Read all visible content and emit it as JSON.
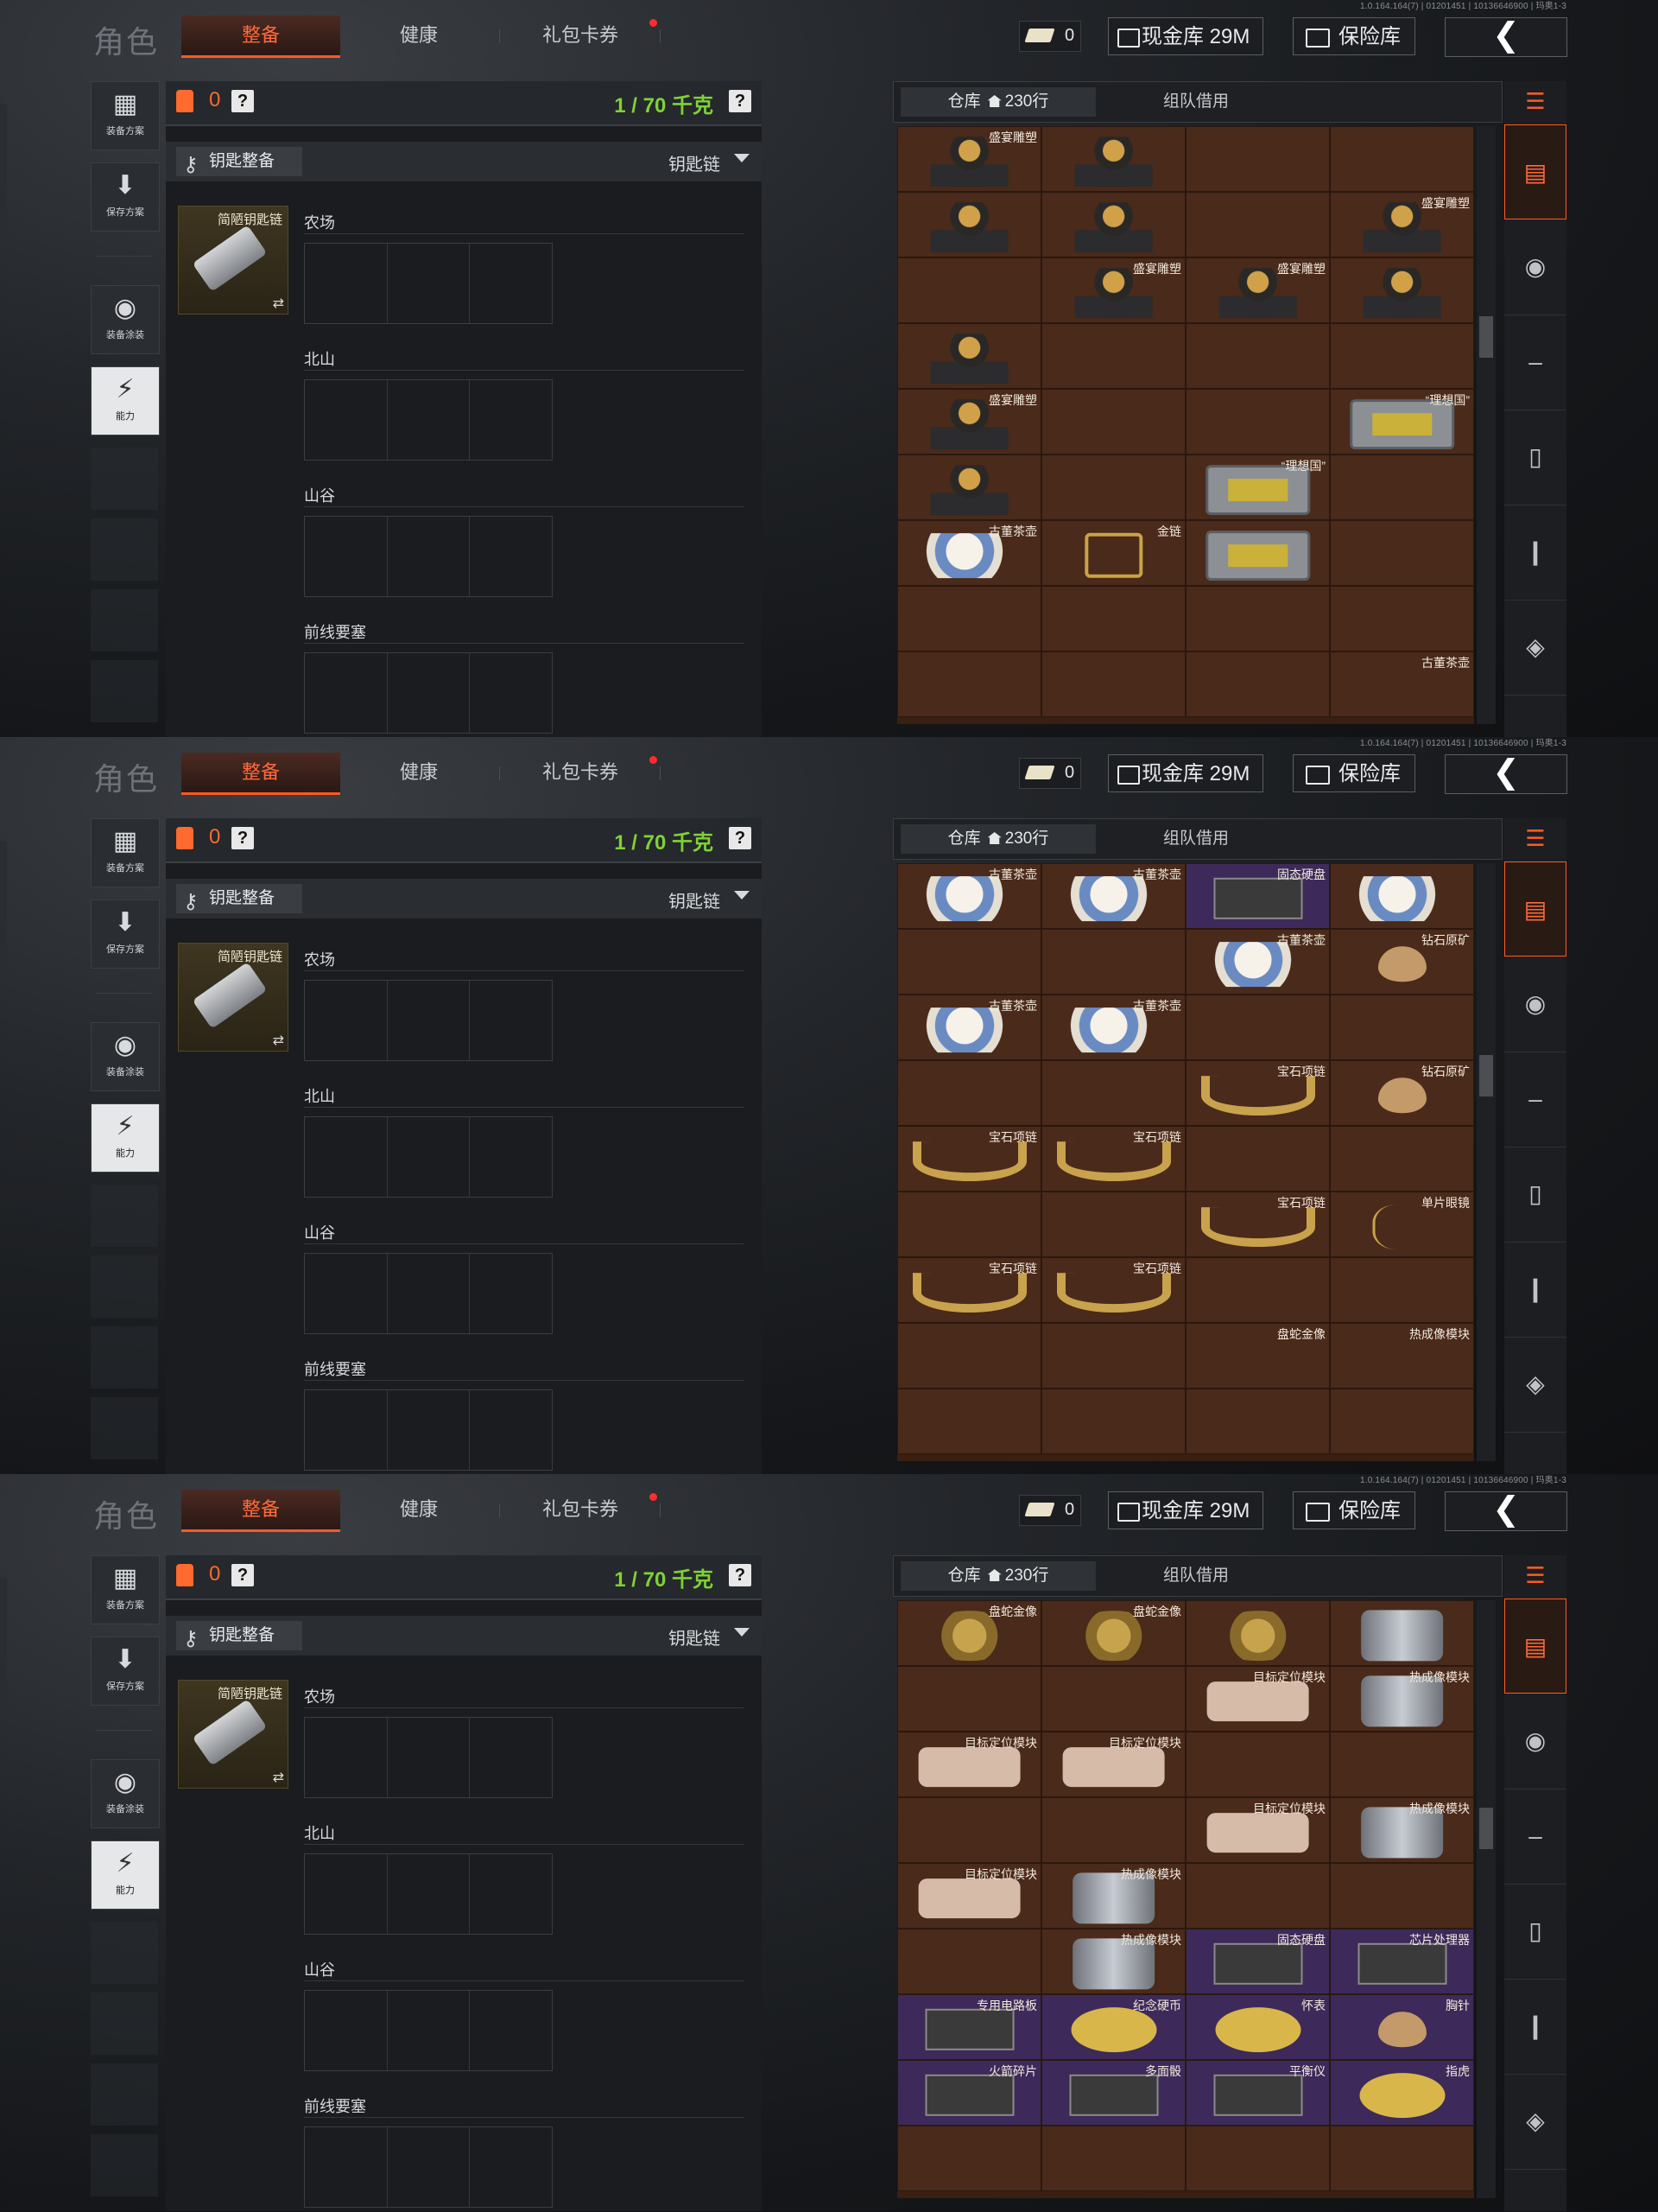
{
  "version": "1.0.164.164(7) | 01201451 | 10136646900 | 玛奥1-3",
  "title": "角色",
  "tabs": {
    "equip": "整备",
    "health": "健康",
    "gift": "礼包卡券"
  },
  "ticket_count": "0",
  "cash_label": "现金库 29M",
  "vault_label": "保险库",
  "back_icon": "chevron-left-icon",
  "left_buttons": [
    "装备方案",
    "保存方案",
    "装备涂装",
    "能力"
  ],
  "capacity": {
    "count": "0",
    "weight": "1 / 70 千克",
    "help": "?"
  },
  "key_section": {
    "button": "钥匙整备",
    "dropdown": "钥匙链"
  },
  "key_item": {
    "name": "简陋钥匙链"
  },
  "regions": [
    "农场",
    "北山",
    "山谷",
    "前线要塞"
  ],
  "inventory": {
    "tab_store": "仓库",
    "rows": "230行",
    "tab_team": "组队借用"
  },
  "screens": [
    {
      "cells": [
        {
          "name": "盛宴雕塑",
          "art": "bust",
          "purple": false
        },
        {
          "name": "",
          "art": "bust",
          "purple": false
        },
        {
          "name": "",
          "art": "",
          "purple": false
        },
        {
          "name": "",
          "art": "",
          "purple": false
        },
        {
          "name": "",
          "art": "bust",
          "purple": false
        },
        {
          "name": "",
          "art": "bust",
          "purple": false
        },
        {
          "name": "",
          "art": "",
          "purple": false
        },
        {
          "name": "盛宴雕塑",
          "art": "bust",
          "purple": false
        },
        {
          "name": "",
          "art": "",
          "purple": false
        },
        {
          "name": "盛宴雕塑",
          "art": "bust",
          "purple": false
        },
        {
          "name": "盛宴雕塑",
          "art": "bust",
          "purple": false
        },
        {
          "name": "",
          "art": "bust",
          "purple": false
        },
        {
          "name": "",
          "art": "bust",
          "purple": false
        },
        {
          "name": "",
          "art": "",
          "purple": false
        },
        {
          "name": "",
          "art": "",
          "purple": false
        },
        {
          "name": "",
          "art": "",
          "purple": false
        },
        {
          "name": "盛宴雕塑",
          "art": "bust",
          "purple": false
        },
        {
          "name": "",
          "art": "",
          "purple": false
        },
        {
          "name": "",
          "art": "",
          "purple": false
        },
        {
          "name": "“理想国”",
          "art": "box",
          "purple": false
        },
        {
          "name": "",
          "art": "bust",
          "purple": false
        },
        {
          "name": "",
          "art": "",
          "purple": false
        },
        {
          "name": "“理想国”",
          "art": "box",
          "purple": false
        },
        {
          "name": "",
          "art": "",
          "purple": false
        },
        {
          "name": "古董茶壶",
          "art": "teapot",
          "purple": false
        },
        {
          "name": "金链",
          "art": "chain",
          "purple": false
        },
        {
          "name": "",
          "art": "box",
          "purple": false
        },
        {
          "name": "",
          "art": "",
          "purple": false
        },
        {
          "name": "",
          "art": "",
          "purple": false
        },
        {
          "name": "",
          "art": "",
          "purple": false
        },
        {
          "name": "",
          "art": "",
          "purple": false
        },
        {
          "name": "",
          "art": "",
          "purple": false
        },
        {
          "name": "",
          "art": "",
          "purple": false
        },
        {
          "name": "",
          "art": "",
          "purple": false
        },
        {
          "name": "",
          "art": "",
          "purple": false
        },
        {
          "name": "古董茶壶",
          "art": "",
          "purple": false
        }
      ]
    },
    {
      "cells": [
        {
          "name": "古董茶壶",
          "art": "teapot",
          "purple": false
        },
        {
          "name": "古董茶壶",
          "art": "teapot",
          "purple": false
        },
        {
          "name": "固态硬盘",
          "art": "chip",
          "purple": true
        },
        {
          "name": "",
          "art": "teapot",
          "purple": false
        },
        {
          "name": "",
          "art": "",
          "purple": false
        },
        {
          "name": "",
          "art": "",
          "purple": false
        },
        {
          "name": "古董茶壶",
          "art": "teapot",
          "purple": false
        },
        {
          "name": "钻石原矿",
          "art": "egg",
          "purple": false
        },
        {
          "name": "古董茶壶",
          "art": "teapot",
          "purple": false
        },
        {
          "name": "古董茶壶",
          "art": "teapot",
          "purple": false
        },
        {
          "name": "",
          "art": "",
          "purple": false
        },
        {
          "name": "",
          "art": "",
          "purple": false
        },
        {
          "name": "",
          "art": "",
          "purple": false
        },
        {
          "name": "",
          "art": "",
          "purple": false
        },
        {
          "name": "宝石项链",
          "art": "necklace",
          "purple": false
        },
        {
          "name": "钻石原矿",
          "art": "egg",
          "purple": false
        },
        {
          "name": "宝石项链",
          "art": "necklace",
          "purple": false
        },
        {
          "name": "宝石项链",
          "art": "necklace",
          "purple": false
        },
        {
          "name": "",
          "art": "",
          "purple": false
        },
        {
          "name": "",
          "art": "",
          "purple": false
        },
        {
          "name": "",
          "art": "",
          "purple": false
        },
        {
          "name": "",
          "art": "",
          "purple": false
        },
        {
          "name": "宝石项链",
          "art": "necklace",
          "purple": false
        },
        {
          "name": "单片眼镜",
          "art": "mono",
          "purple": false
        },
        {
          "name": "宝石项链",
          "art": "necklace",
          "purple": false
        },
        {
          "name": "宝石项链",
          "art": "necklace",
          "purple": false
        },
        {
          "name": "",
          "art": "",
          "purple": false
        },
        {
          "name": "",
          "art": "",
          "purple": false
        },
        {
          "name": "",
          "art": "",
          "purple": false
        },
        {
          "name": "",
          "art": "",
          "purple": false
        },
        {
          "name": "盘蛇金像",
          "art": "",
          "purple": false
        },
        {
          "name": "热成像模块",
          "art": "",
          "purple": false
        },
        {
          "name": "",
          "art": "",
          "purple": false
        },
        {
          "name": "",
          "art": "",
          "purple": false
        },
        {
          "name": "",
          "art": "",
          "purple": false
        },
        {
          "name": "",
          "art": "",
          "purple": false
        }
      ]
    },
    {
      "cells": [
        {
          "name": "盘蛇金像",
          "art": "snake",
          "purple": false
        },
        {
          "name": "盘蛇金像",
          "art": "snake",
          "purple": false
        },
        {
          "name": "",
          "art": "snake",
          "purple": false
        },
        {
          "name": "",
          "art": "thermal",
          "purple": false
        },
        {
          "name": "",
          "art": "",
          "purple": false
        },
        {
          "name": "",
          "art": "",
          "purple": false
        },
        {
          "name": "目标定位模块",
          "art": "laser",
          "purple": false
        },
        {
          "name": "热成像模块",
          "art": "thermal",
          "purple": false
        },
        {
          "name": "目标定位模块",
          "art": "laser",
          "purple": false
        },
        {
          "name": "目标定位模块",
          "art": "laser",
          "purple": false
        },
        {
          "name": "",
          "art": "",
          "purple": false
        },
        {
          "name": "",
          "art": "",
          "purple": false
        },
        {
          "name": "",
          "art": "",
          "purple": false
        },
        {
          "name": "",
          "art": "",
          "purple": false
        },
        {
          "name": "目标定位模块",
          "art": "laser",
          "purple": false
        },
        {
          "name": "热成像模块",
          "art": "thermal",
          "purple": false
        },
        {
          "name": "目标定位模块",
          "art": "laser",
          "purple": false
        },
        {
          "name": "热成像模块",
          "art": "thermal",
          "purple": false
        },
        {
          "name": "",
          "art": "",
          "purple": false
        },
        {
          "name": "",
          "art": "",
          "purple": false
        },
        {
          "name": "",
          "art": "",
          "purple": false
        },
        {
          "name": "热成像模块",
          "art": "thermal",
          "purple": false
        },
        {
          "name": "固态硬盘",
          "art": "chip",
          "purple": true
        },
        {
          "name": "芯片处理器",
          "art": "chip",
          "purple": true
        },
        {
          "name": "专用电路板",
          "art": "chip",
          "purple": true
        },
        {
          "name": "纪念硬币",
          "art": "coin",
          "purple": true
        },
        {
          "name": "怀表",
          "art": "coin",
          "purple": true
        },
        {
          "name": "胸针",
          "art": "egg",
          "purple": true
        },
        {
          "name": "火箭碎片",
          "art": "chip",
          "purple": true
        },
        {
          "name": "多面骰",
          "art": "chip",
          "purple": true
        },
        {
          "name": "平衡仪",
          "art": "chip",
          "purple": true
        },
        {
          "name": "指虎",
          "art": "coin",
          "purple": true
        },
        {
          "name": "",
          "art": "",
          "purple": false
        },
        {
          "name": "",
          "art": "",
          "purple": false
        },
        {
          "name": "",
          "art": "",
          "purple": false
        },
        {
          "name": "",
          "art": "",
          "purple": false
        }
      ]
    }
  ]
}
